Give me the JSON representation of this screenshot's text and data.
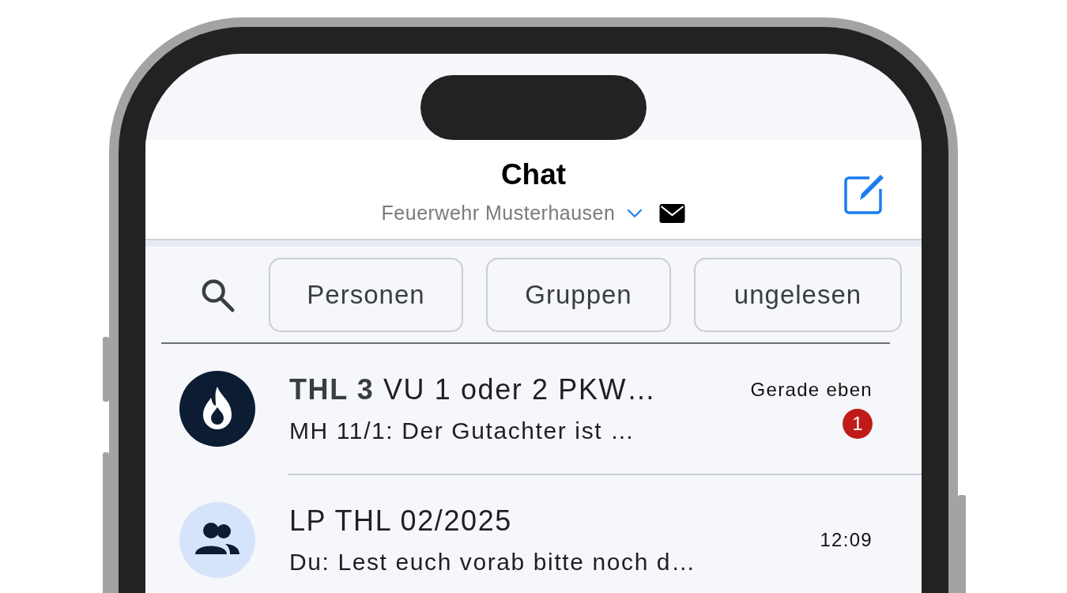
{
  "header": {
    "title": "Chat",
    "organization": "Feuerwehr Musterhausen"
  },
  "filters": [
    {
      "label": "Personen"
    },
    {
      "label": "Gruppen"
    },
    {
      "label": "ungelesen"
    }
  ],
  "chats": [
    {
      "kind": "incident",
      "title": "**THL 3** VU 1 oder 2 PKW…",
      "preview": "MH 11/1: Der Gutachter ist …",
      "time": "Gerade eben",
      "unread": "1"
    },
    {
      "kind": "group",
      "title": "LP THL 02/2025",
      "preview": "Du: Lest euch vorab bitte noch d…",
      "time": "12:09"
    }
  ]
}
